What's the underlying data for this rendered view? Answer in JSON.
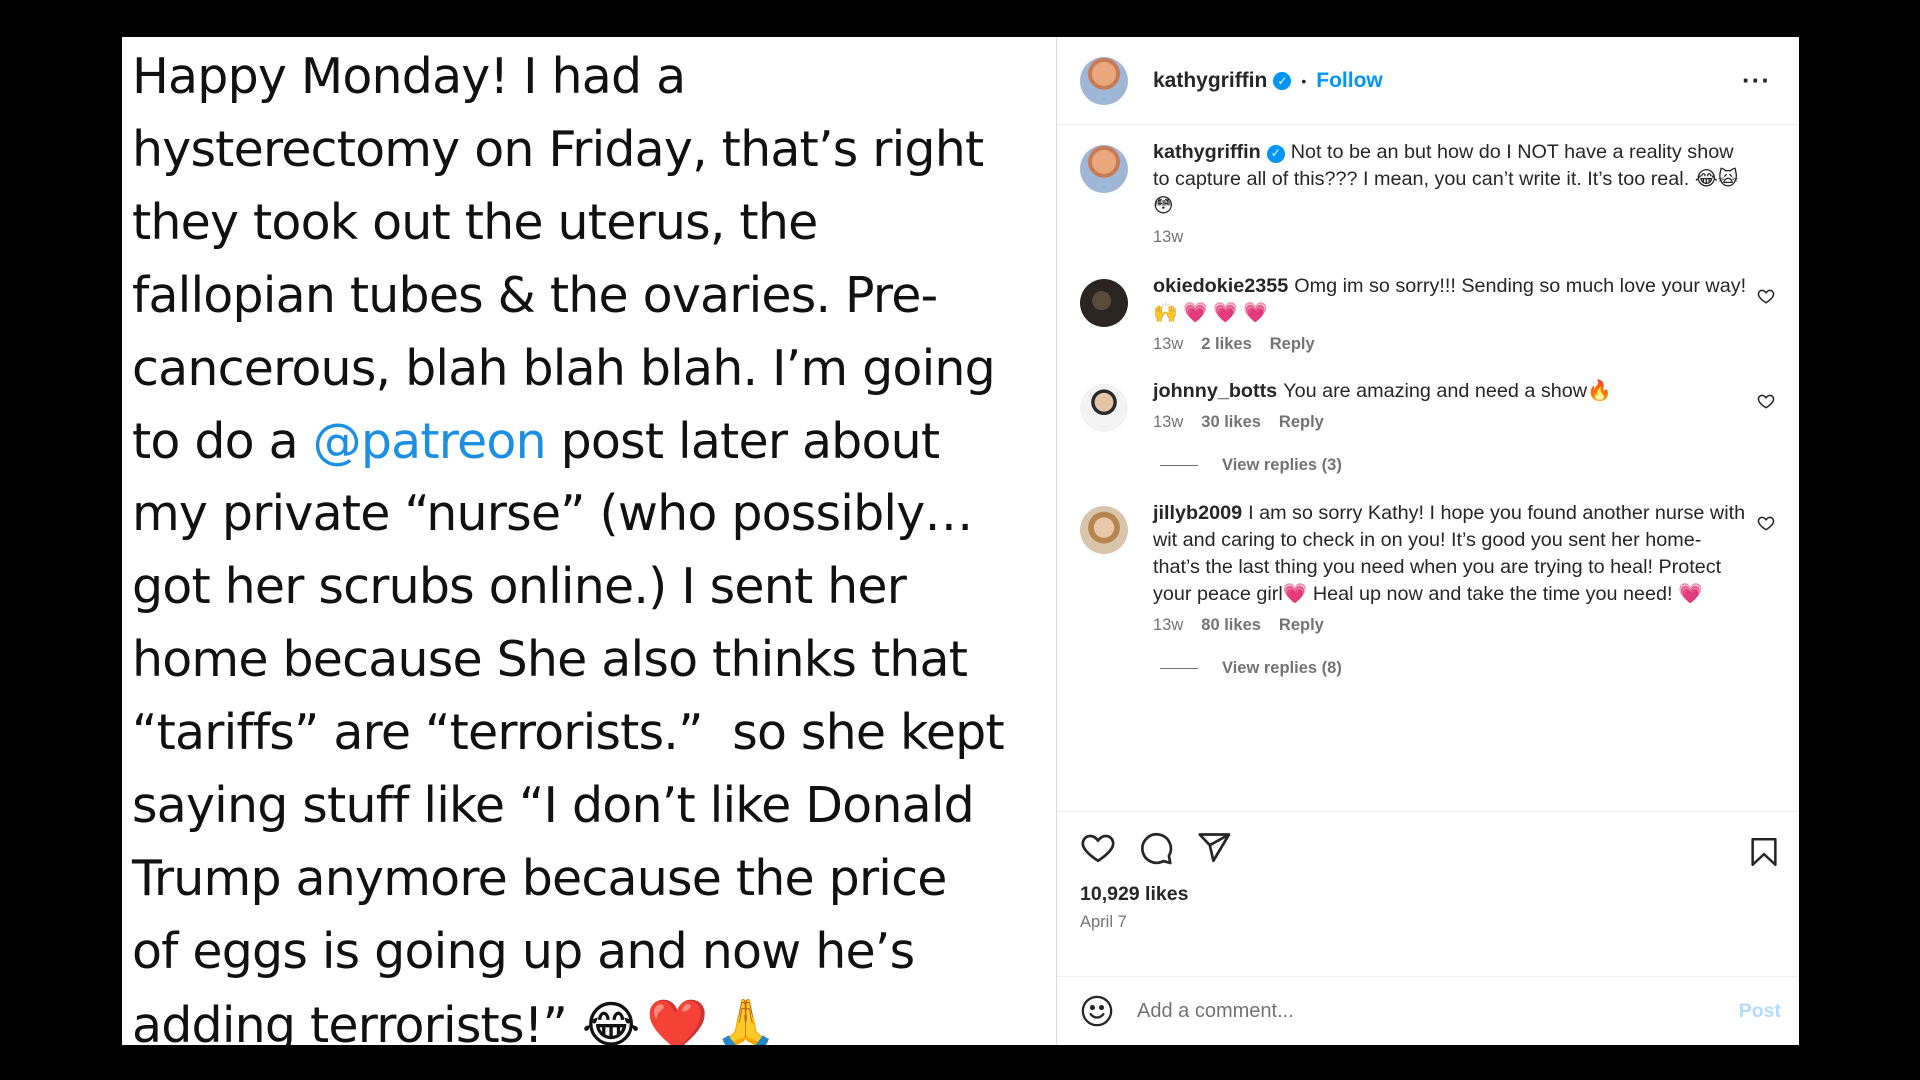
{
  "post": {
    "image_text_parts": {
      "before_mention": "Happy Monday! I had a\nhysterectomy on Friday, that’s right\nthey took out the uterus, the\nfallopian tubes & the ovaries. Pre-\ncancerous, blah blah blah. I’m going\nto do a ",
      "mention": "@patreon",
      "after_mention": " post later about\nmy private “nurse” (who possibly…\ngot her scrubs online.) I sent her\nhome because She also thinks that\n“tariffs” are “terrorists.”  so she kept\nsaying stuff like “I don’t like Donald\nTrump anymore because the price\nof eggs is going up and now he’s\nadding terrorists!” ",
      "emojis": "😂❤️🙏"
    }
  },
  "header": {
    "username": "kathygriffin",
    "verified_mark": "✓",
    "separator": "•",
    "follow_label": "Follow",
    "more_label": "···"
  },
  "comments": [
    {
      "user": "kathygriffin",
      "verified_mark": "✓",
      "text": "Not to be an           but how do I NOT have a reality show to capture all of this??? I mean, you can’t write it. It’s too real. 😂🙀😳",
      "time": "13w"
    },
    {
      "user": "okiedokie2355",
      "text": "Omg im so sorry!!! Sending so much love your way!🙌 💗 💗 💗",
      "time": "13w",
      "likes": "2 likes",
      "reply": "Reply"
    },
    {
      "user": "johnny_botts",
      "text": "You are amazing and need a show🔥",
      "time": "13w",
      "likes": "30 likes",
      "reply": "Reply",
      "view_replies": "View replies (3)"
    },
    {
      "user": "jillyb2009",
      "text": "I am so sorry Kathy! I hope you found another nurse with wit and caring to check in on you! It’s good you sent her home- that’s the last thing you need when you are trying to heal! Protect your peace girl💗 Heal up now and take the time you need! 💗",
      "time": "13w",
      "likes": "80 likes",
      "reply": "Reply",
      "view_replies": "View replies (8)"
    }
  ],
  "footer": {
    "likes": "10,929 likes",
    "date": "April 7",
    "comment_placeholder": "Add a comment...",
    "post_label": "Post"
  },
  "icons": {
    "like": "heart-icon",
    "comment": "comment-icon",
    "share": "share-icon",
    "save": "bookmark-icon",
    "emoji": "emoji-icon"
  },
  "colors": {
    "accent": "#0095f6",
    "verified": "#0095f6",
    "post_disabled": "#b3dbff",
    "mention": "#1a8fe3"
  }
}
